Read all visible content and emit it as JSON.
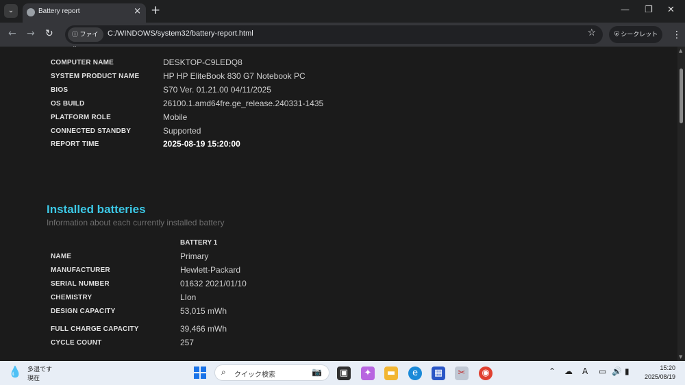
{
  "browser": {
    "tab_title": "Battery report",
    "omnibox_chip": "ファイル",
    "url": "C:/WINDOWS/system32/battery-report.html",
    "incognito_label": "シークレット"
  },
  "system_info": {
    "rows": [
      {
        "label": "COMPUTER NAME",
        "value": "DESKTOP-C9LEDQ8"
      },
      {
        "label": "SYSTEM PRODUCT NAME",
        "value": "HP HP EliteBook 830 G7 Notebook PC"
      },
      {
        "label": "BIOS",
        "value": "S70 Ver. 01.21.00 04/11/2025"
      },
      {
        "label": "OS BUILD",
        "value": "26100.1.amd64fre.ge_release.240331-1435"
      },
      {
        "label": "PLATFORM ROLE",
        "value": "Mobile"
      },
      {
        "label": "CONNECTED STANDBY",
        "value": "Supported"
      },
      {
        "label": "REPORT TIME",
        "value": "2025-08-19  15:20:00"
      }
    ]
  },
  "installed_batteries": {
    "title": "Installed batteries",
    "subtitle": "Information about each currently installed battery",
    "column_header": "BATTERY 1",
    "rows": [
      {
        "label": "NAME",
        "value": "Primary"
      },
      {
        "label": "MANUFACTURER",
        "value": "Hewlett-Packard"
      },
      {
        "label": "SERIAL NUMBER",
        "value": "01632 2021/01/10"
      },
      {
        "label": "CHEMISTRY",
        "value": "LIon"
      },
      {
        "label": "DESIGN CAPACITY",
        "value": "53,015 mWh"
      },
      {
        "label": "FULL CHARGE CAPACITY",
        "value": "39,466 mWh"
      },
      {
        "label": "CYCLE COUNT",
        "value": "257"
      }
    ]
  },
  "taskbar": {
    "weather_line1": "多湿です",
    "weather_line2": "現在",
    "search_placeholder": "クイック検索",
    "time": "15:20",
    "date": "2025/08/19"
  }
}
